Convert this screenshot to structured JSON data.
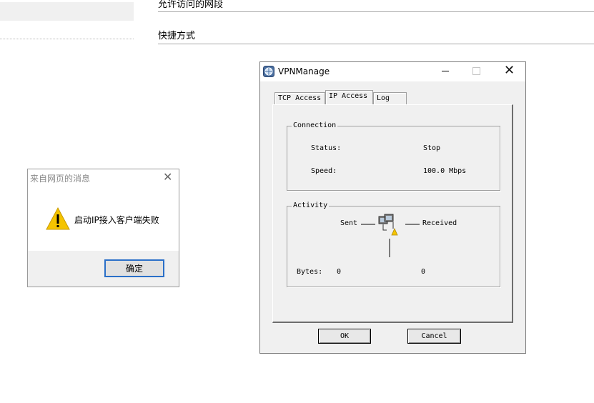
{
  "background_page": {
    "heading_top": "允许访问的网段",
    "heading_shortcut": "快捷方式"
  },
  "message_box": {
    "title": "来自网页的消息",
    "message": "启动IP接入客户端失败",
    "ok_label": "确定",
    "icon": "warning-icon"
  },
  "vpn_window": {
    "title": "VPNManage",
    "tabs": [
      {
        "label": "TCP Access",
        "active": false
      },
      {
        "label": "IP Access",
        "active": true
      },
      {
        "label": "Log",
        "active": false
      }
    ],
    "connection": {
      "legend": "Connection",
      "status_label": "Status:",
      "status_value": "Stop",
      "speed_label": "Speed:",
      "speed_value": "100.0 Mbps"
    },
    "activity": {
      "legend": "Activity",
      "sent_label": "Sent",
      "received_label": "Received",
      "bytes_label": "Bytes:",
      "bytes_sent": "0",
      "bytes_received": "0",
      "icon": "network-computers-icon"
    },
    "buttons": {
      "ok": "OK",
      "cancel": "Cancel"
    }
  },
  "colors": {
    "dialog_bg": "#f0f0f0",
    "focus_border": "#2a6fc8",
    "warning_yellow": "#f5c400"
  }
}
